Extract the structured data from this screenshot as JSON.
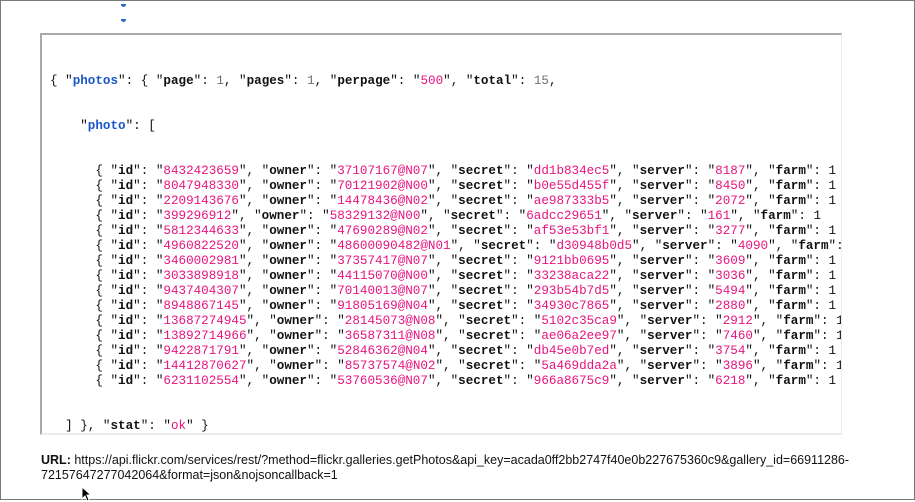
{
  "json_response": {
    "root_key": "photos",
    "page_key": "page",
    "page": 1,
    "pages_key": "pages",
    "pages": 1,
    "perpage_key": "perpage",
    "perpage": "500",
    "total_key": "total",
    "total": 15,
    "photo_key": "photo",
    "photos": [
      {
        "id": "8432423659",
        "owner": "37107167@N07",
        "secret": "dd1b834ec5",
        "server": "8187"
      },
      {
        "id": "8047948330",
        "owner": "70121902@N00",
        "secret": "b0e55d455f",
        "server": "8450"
      },
      {
        "id": "2209143676",
        "owner": "14478436@N02",
        "secret": "ae987333b5",
        "server": "2072"
      },
      {
        "id": "399296912",
        "owner": "58329132@N00",
        "secret": "6adcc29651",
        "server": "161"
      },
      {
        "id": "5812344633",
        "owner": "47690289@N02",
        "secret": "af53e53bf1",
        "server": "3277"
      },
      {
        "id": "4960822520",
        "owner": "48600090482@N01",
        "secret": "d30948b0d5",
        "server": "4090"
      },
      {
        "id": "3460002981",
        "owner": "37357417@N07",
        "secret": "9121bb0695",
        "server": "3609"
      },
      {
        "id": "3033898918",
        "owner": "44115070@N00",
        "secret": "33238aca22",
        "server": "3036"
      },
      {
        "id": "9437404307",
        "owner": "70140013@N07",
        "secret": "293b54b7d5",
        "server": "5494"
      },
      {
        "id": "8948867145",
        "owner": "91805169@N04",
        "secret": "34930c7865",
        "server": "2880"
      },
      {
        "id": "13687274945",
        "owner": "28145073@N08",
        "secret": "5102c35ca9",
        "server": "2912"
      },
      {
        "id": "13892714966",
        "owner": "36587311@N08",
        "secret": "ae06a2ee97",
        "server": "7460"
      },
      {
        "id": "9422871791",
        "owner": "52846362@N04",
        "secret": "db45e0b7ed",
        "server": "3754"
      },
      {
        "id": "14412870627",
        "owner": "85737574@N02",
        "secret": "5a469dda2a",
        "server": "3896"
      },
      {
        "id": "6231102554",
        "owner": "53760536@N07",
        "secret": "966a8675c9",
        "server": "6218"
      }
    ],
    "truncated_key": "farm",
    "stat_key": "stat",
    "stat": "ok"
  },
  "url_section": {
    "label": "URL:",
    "value": "https://api.flickr.com/services/rest/?method=flickr.galleries.getPhotos&api_key=acada0ff2bb2747f40e0b227675360c9&gallery_id=66911286-72157647277042064&format=json&nojsoncallback=1"
  },
  "colors": {
    "string": "#e8137f",
    "number": "#707070",
    "highlight_key": "#1a56c7",
    "key": "#111111"
  }
}
